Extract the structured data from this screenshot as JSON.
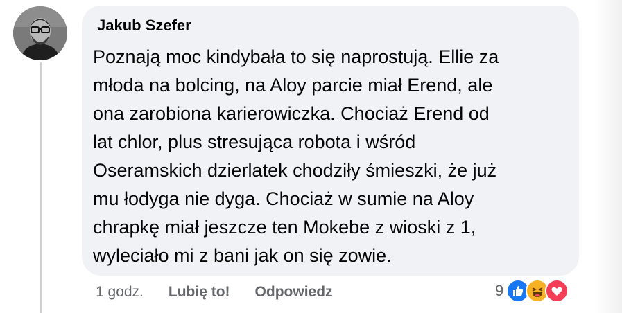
{
  "comment": {
    "author": "Jakub Szefer",
    "text_lines": [
      "Poznają moc kindybała to się naprostują. Ellie za",
      "młoda na bolcing, na Aloy parcie miał Erend, ale",
      "ona zarobiona karierowiczka. Chociaż Erend od",
      "lat chlor, plus stresująca robota i wśród",
      "Oseramskich dzierlatek chodziły śmieszki, że już",
      "mu łodyga nie dyga. Chociaż w sumie na Aloy",
      "chrapkę miał jeszcze ten Mokebe z wioski z 1,",
      "wyleciało mi z bani jak on się zowie."
    ],
    "timestamp": "1 godz.",
    "like_label": "Lubię to!",
    "reply_label": "Odpowiedz",
    "reaction_count": "9",
    "reaction_icons": [
      "like-icon",
      "haha-icon",
      "love-icon"
    ]
  },
  "colors": {
    "bubble": "#f0f2f5",
    "secondary_text": "#65676b",
    "like": "#1877f2",
    "haha": "#f7b125",
    "love": "#f33e58"
  }
}
